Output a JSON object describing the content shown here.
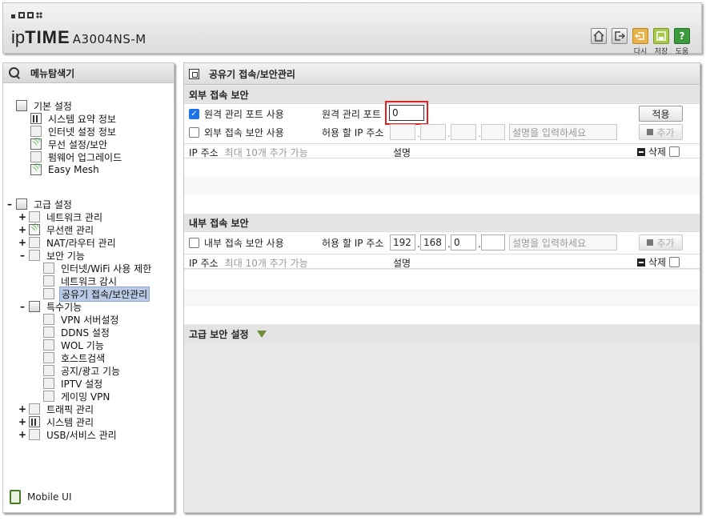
{
  "header": {
    "brand_ip": "ip",
    "brand_time": "TIME",
    "model": "A3004NS-M",
    "buttons": [
      {
        "label": "",
        "icon": "home-icon"
      },
      {
        "label": "",
        "icon": "logout-icon"
      },
      {
        "label": "다시",
        "icon": "restart-icon"
      },
      {
        "label": "저장",
        "icon": "save-icon"
      },
      {
        "label": "도움",
        "icon": "help-icon"
      }
    ],
    "help_glyph": "?"
  },
  "nav": {
    "title": "메뉴탐색기",
    "basic": {
      "label": "기본 설정",
      "items": [
        "시스템 요약 정보",
        "인터넷 설정 정보",
        "무선 설정/보안",
        "펌웨어 업그레이드",
        "Easy Mesh"
      ]
    },
    "advanced": {
      "label": "고급 설정",
      "network": "네트워크 관리",
      "wireless": "무선랜 관리",
      "nat": "NAT/라우터 관리",
      "security": {
        "label": "보안 기능",
        "items": [
          "인터넷/WiFi 사용 제한",
          "네트워크 감시",
          "공유기 접속/보안관리"
        ]
      },
      "special": {
        "label": "특수기능",
        "items": [
          "VPN 서버설정",
          "DDNS 설정",
          "WOL 기능",
          "호스트검색",
          "공지/광고 기능",
          "IPTV 설정",
          "게이밍 VPN"
        ]
      },
      "traffic": "트래픽 관리",
      "system": "시스템 관리",
      "usb": "USB/서비스 관리"
    },
    "mobile": "Mobile UI"
  },
  "main": {
    "title": "공유기 접속/보안관리",
    "external": {
      "heading": "외부 접속 보안",
      "remote_label": "원격 관리 포트 사용",
      "remote_checked": true,
      "port_label": "원격 관리 포트",
      "port_value": "0",
      "apply": "적용",
      "ext_label": "외부 접속 보안 사용",
      "ext_checked": false,
      "ip_label": "허용 할 IP 주소",
      "ip": [
        "",
        "",
        "",
        ""
      ],
      "desc_placeholder": "설명을 입력하세요",
      "add": "추가",
      "list_ip": "IP 주소",
      "list_max": "최대 10개 추가 가능",
      "list_desc": "설명",
      "list_delete": "삭제"
    },
    "internal": {
      "heading": "내부 접속 보안",
      "int_label": "내부 접속 보안 사용",
      "int_checked": false,
      "ip_label": "허용 할 IP 주소",
      "ip": [
        "192",
        "168",
        "0",
        ""
      ],
      "desc_placeholder": "설명을 입력하세요",
      "add": "추가",
      "list_ip": "IP 주소",
      "list_max": "최대 10개 추가 가능",
      "list_desc": "설명",
      "list_delete": "삭제"
    },
    "advanced_heading": "고급 보안 설정"
  }
}
